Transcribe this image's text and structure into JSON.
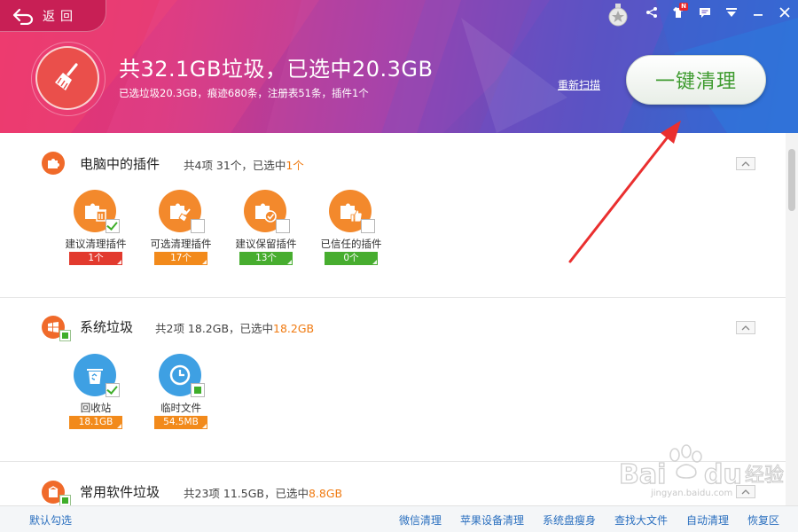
{
  "header": {
    "back_label": "返回",
    "notification_badge": "N",
    "headline": "共32.1GB垃圾，已选中20.3GB",
    "subline": "已选垃圾20.3GB，痕迹680条，注册表51条，插件1个",
    "rescan_label": "重新扫描",
    "clean_button_label": "一键清理",
    "colors": {
      "gradient_start": "#e9336e",
      "gradient_end": "#2f6fd6"
    }
  },
  "sections": [
    {
      "title": "电脑中的插件",
      "summary_prefix": "共4项 31个，已选中",
      "summary_value": "1个",
      "items": [
        {
          "label": "建议清理插件",
          "badge": "1个",
          "state": "checked",
          "icon": "plugin-trash-icon"
        },
        {
          "label": "可选清理插件",
          "badge": "17个",
          "state": "unchecked",
          "icon": "plugin-broom-icon"
        },
        {
          "label": "建议保留插件",
          "badge": "13个",
          "state": "unchecked",
          "icon": "plugin-check-icon"
        },
        {
          "label": "已信任的插件",
          "badge": "0个",
          "state": "unchecked",
          "icon": "plugin-thumbsup-icon"
        }
      ]
    },
    {
      "title": "系统垃圾",
      "summary_prefix": "共2项 18.2GB，已选中",
      "summary_value": "18.2GB",
      "items": [
        {
          "label": "回收站",
          "badge": "18.1GB",
          "state": "checked",
          "icon": "recycle-bin-icon"
        },
        {
          "label": "临时文件",
          "badge": "54.5MB",
          "state": "partial",
          "icon": "clock-icon"
        }
      ]
    },
    {
      "title": "常用软件垃圾",
      "summary_prefix": "共23项 11.5GB，已选中",
      "summary_value": "8.8GB"
    }
  ],
  "footer": {
    "default_select": "默认勾选",
    "links": [
      "微信清理",
      "苹果设备清理",
      "系统盘瘦身",
      "查找大文件",
      "自动清理",
      "恢复区"
    ]
  },
  "watermark": {
    "brand": "Bai",
    "brand2": "du",
    "cn": "经验",
    "url": "jingyan.baidu.com"
  }
}
